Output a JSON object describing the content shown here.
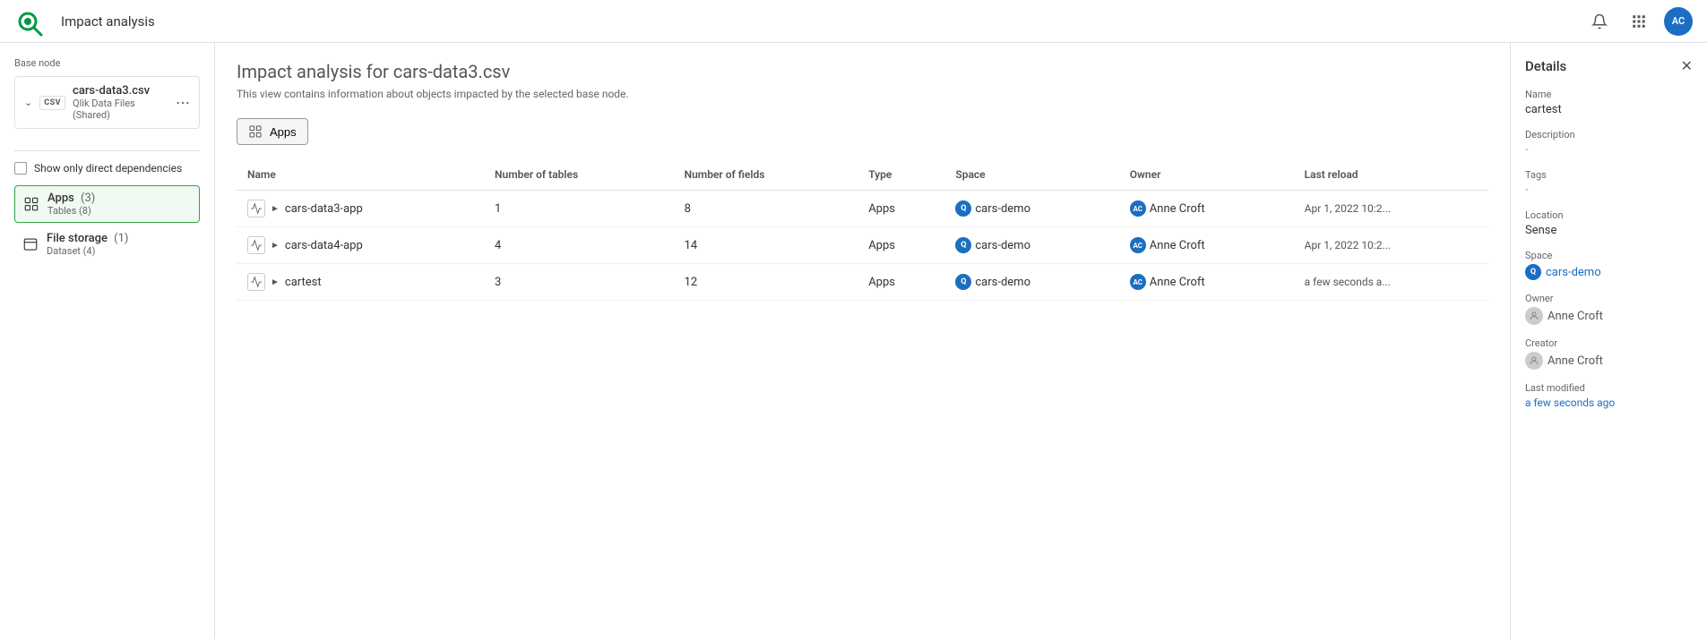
{
  "topnav": {
    "title": "Impact analysis",
    "logo_alt": "Qlik",
    "avatar_initials": "AC"
  },
  "sidebar": {
    "base_node_label": "Base node",
    "base_node_name": "cars-data3.csv",
    "base_node_sub": "Qlik Data Files (Shared)",
    "show_deps_label": "Show only direct dependencies",
    "tree_items": [
      {
        "name": "Apps",
        "count": "(3)",
        "sub": "Tables (8)",
        "active": true
      },
      {
        "name": "File storage",
        "count": "(1)",
        "sub": "Dataset (4)",
        "active": false
      }
    ]
  },
  "main": {
    "title": "Impact analysis for cars-data3.csv",
    "description": "This view contains information about objects impacted by the selected base node.",
    "apps_tab_label": "Apps",
    "table": {
      "columns": [
        "Name",
        "Number of tables",
        "Number of fields",
        "Type",
        "Space",
        "Owner",
        "Last reload"
      ],
      "rows": [
        {
          "name": "cars-data3-app",
          "expanded": false,
          "num_tables": "1",
          "num_fields": "8",
          "type": "Apps",
          "space": "cars-demo",
          "owner": "Anne Croft",
          "last_reload": "Apr 1, 2022 10:2..."
        },
        {
          "name": "cars-data4-app",
          "expanded": false,
          "num_tables": "4",
          "num_fields": "14",
          "type": "Apps",
          "space": "cars-demo",
          "owner": "Anne Croft",
          "last_reload": "Apr 1, 2022 10:2..."
        },
        {
          "name": "cartest",
          "expanded": false,
          "num_tables": "3",
          "num_fields": "12",
          "type": "Apps",
          "space": "cars-demo",
          "owner": "Anne Croft",
          "last_reload": "a few seconds a..."
        }
      ]
    }
  },
  "details_panel": {
    "title": "Details",
    "name_label": "Name",
    "name_value": "cartest",
    "description_label": "Description",
    "description_value": "-",
    "tags_label": "Tags",
    "tags_value": "-",
    "location_label": "Location",
    "location_value": "Sense",
    "space_label": "Space",
    "space_value": "cars-demo",
    "space_icon": "Q",
    "owner_label": "Owner",
    "owner_value": "Anne Croft",
    "creator_label": "Creator",
    "creator_value": "Anne Croft",
    "last_modified_label": "Last modified",
    "last_modified_value": "a few seconds ago"
  }
}
